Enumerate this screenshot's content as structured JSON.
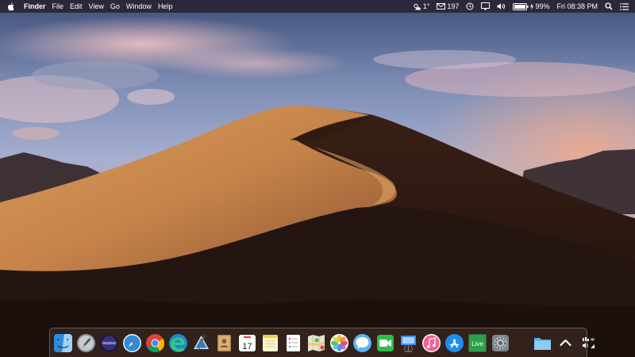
{
  "menubar": {
    "app_name": "Finder",
    "menus": [
      "File",
      "Edit",
      "View",
      "Go",
      "Window",
      "Help"
    ],
    "status": {
      "weather": "1°",
      "mail_count": "197",
      "battery": "99%",
      "clock": "Fri 08:38 PM"
    },
    "icons": [
      "apple-icon",
      "weather-icon",
      "mail-icon",
      "time-machine-icon",
      "display-icon",
      "volume-icon",
      "battery-icon",
      "search-icon",
      "notification-center-icon"
    ]
  },
  "dock": {
    "apps": [
      {
        "name": "Finder",
        "icon": "finder-icon"
      },
      {
        "name": "Launchpad",
        "icon": "launchpad-icon"
      },
      {
        "name": "Siri",
        "icon": "siri-icon"
      },
      {
        "name": "Safari",
        "icon": "safari-icon"
      },
      {
        "name": "Chrome",
        "icon": "chrome-icon"
      },
      {
        "name": "Edge",
        "icon": "edge-icon"
      },
      {
        "name": "Xcode",
        "icon": "xcode-icon"
      },
      {
        "name": "Contacts",
        "icon": "contacts-icon"
      },
      {
        "name": "Calendar",
        "icon": "calendar-icon",
        "label": "17"
      },
      {
        "name": "Notes",
        "icon": "notes-icon"
      },
      {
        "name": "Reminders",
        "icon": "reminders-icon"
      },
      {
        "name": "Maps",
        "icon": "maps-icon"
      },
      {
        "name": "Photos",
        "icon": "photos-icon"
      },
      {
        "name": "Messages",
        "icon": "messages-icon"
      },
      {
        "name": "FaceTime",
        "icon": "facetime-icon"
      },
      {
        "name": "Keynote",
        "icon": "keynote-icon"
      },
      {
        "name": "iTunes",
        "icon": "itunes-icon"
      },
      {
        "name": "App Store",
        "icon": "app-store-icon"
      },
      {
        "name": "Live",
        "icon": "live-icon",
        "label": "Live"
      },
      {
        "name": "System Preferences",
        "icon": "system-preferences-icon"
      }
    ],
    "right": [
      {
        "name": "Folder",
        "icon": "folder-icon"
      },
      {
        "name": "Up arrow",
        "icon": "up-arrow-icon"
      },
      {
        "name": "Utilities",
        "icon": "utilities-icon"
      }
    ]
  }
}
